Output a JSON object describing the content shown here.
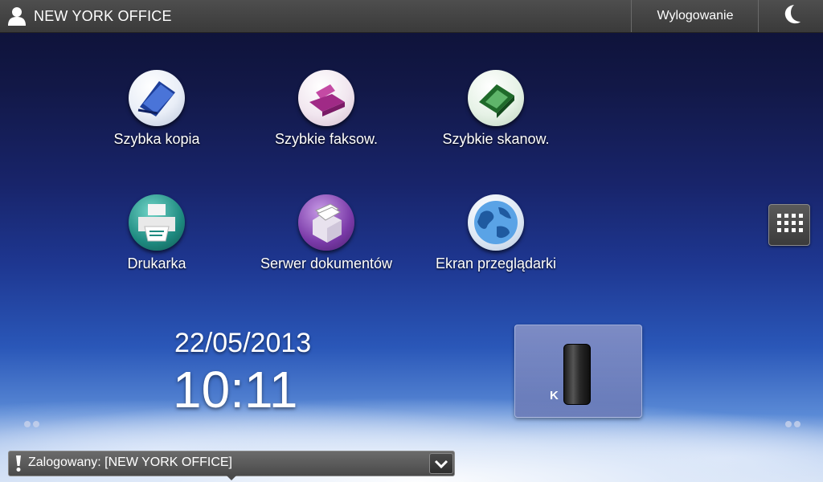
{
  "header": {
    "title": "NEW YORK OFFICE",
    "logout_label": "Wylogowanie"
  },
  "apps": [
    {
      "label": "Szybka kopia",
      "icon": "copy-icon",
      "color": "#3a64c8"
    },
    {
      "label": "Szybkie faksow.",
      "icon": "fax-icon",
      "color": "#b0308c"
    },
    {
      "label": "Szybkie skanow.",
      "icon": "scanner-icon",
      "color": "#2f8a3a"
    },
    {
      "label": "Drukarka",
      "icon": "printer-icon",
      "color": "#1e8a80"
    },
    {
      "label": "Serwer dokumentów",
      "icon": "document-server-icon",
      "color": "#7a3aa8"
    },
    {
      "label": "Ekran przeglądarki",
      "icon": "globe-icon",
      "color": "#2a78c8"
    }
  ],
  "clock": {
    "date": "22/05/2013",
    "time": "10:11"
  },
  "toner": {
    "label": "K",
    "level": 1.0
  },
  "status": {
    "text": "Zalogowany: [NEW YORK OFFICE]"
  }
}
